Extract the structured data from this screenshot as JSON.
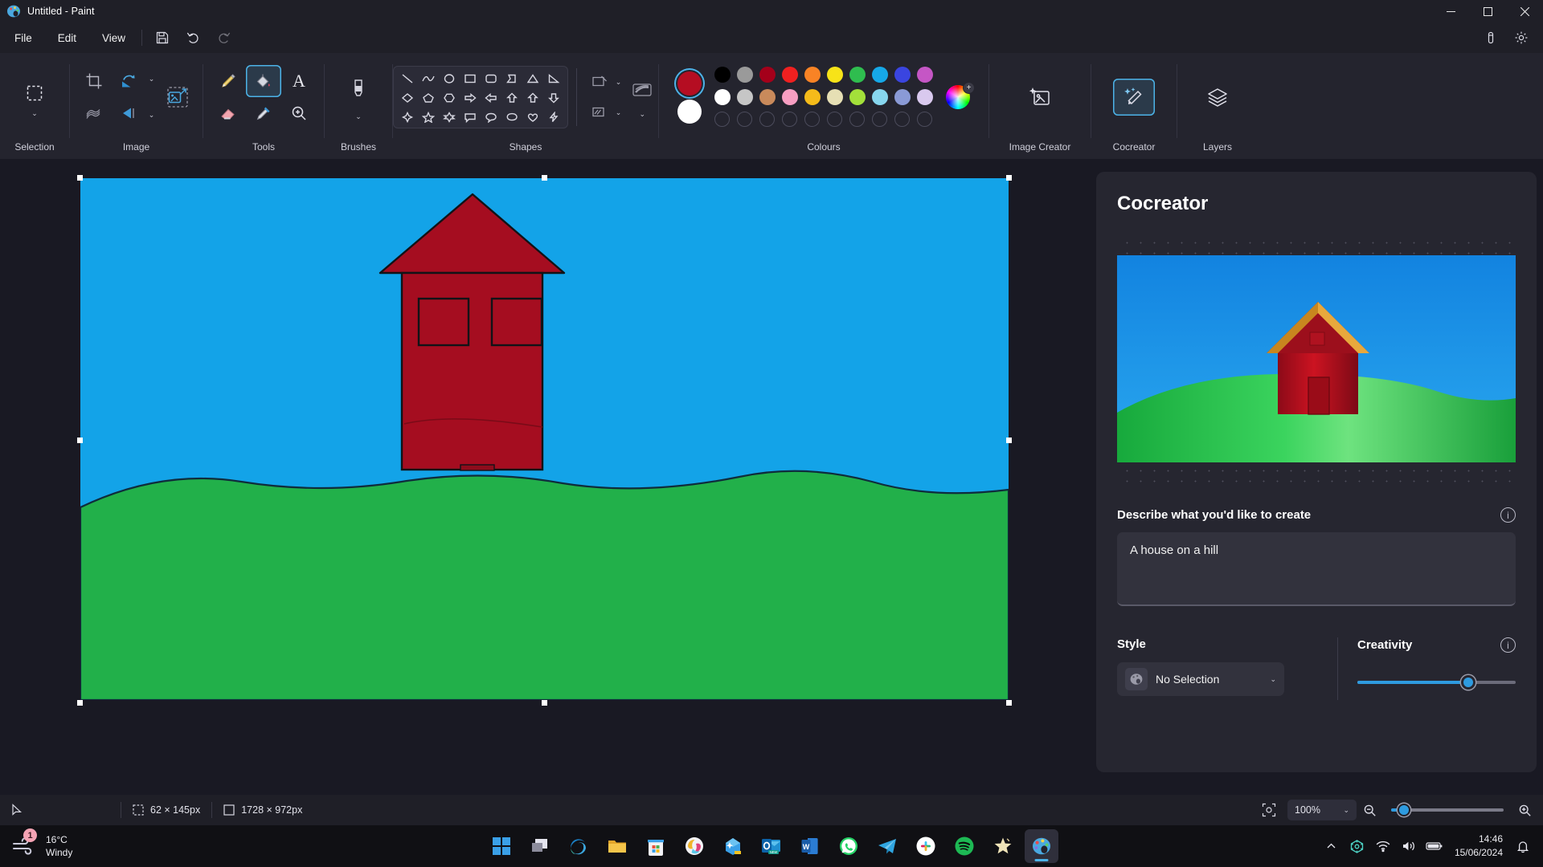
{
  "window": {
    "title": "Untitled - Paint",
    "app_icon": "paint-palette-icon",
    "minimize": "minimize-icon",
    "maximize": "maximize-icon",
    "close": "close-icon"
  },
  "menubar": {
    "items": [
      {
        "label": "File"
      },
      {
        "label": "Edit"
      },
      {
        "label": "View"
      }
    ],
    "save_icon": "save-icon",
    "undo_icon": "undo-icon",
    "redo_icon": "redo-icon",
    "pen_tip_icon": "pen-pressure-icon",
    "settings_icon": "gear-icon"
  },
  "ribbon": {
    "groups": [
      {
        "label": "Selection"
      },
      {
        "label": "Image"
      },
      {
        "label": "Tools"
      },
      {
        "label": "Brushes"
      },
      {
        "label": "Shapes"
      },
      {
        "label": "Colours"
      },
      {
        "label": "Image Creator"
      },
      {
        "label": "Cocreator"
      },
      {
        "label": "Layers"
      }
    ],
    "selection": {
      "icon": "rectangular-selection-icon",
      "caret": "chevron-down-icon"
    },
    "image": {
      "crop": "crop-icon",
      "rotate": "rotate-icon",
      "rotate_caret": "chevron-down-icon",
      "resize": "resize-skew-icon",
      "flip": "flip-icon",
      "flip_caret": "chevron-down-icon",
      "resize_image": "resize-image-icon"
    },
    "tools": {
      "pencil": "pencil-icon",
      "fill": "paint-bucket-icon",
      "text": "text-tool-icon",
      "eraser": "eraser-icon",
      "picker": "colour-picker-icon",
      "magnifier": "magnifier-icon",
      "active_tool": "paint-bucket-icon"
    },
    "brushes": {
      "icon": "brush-icon",
      "caret": "chevron-down-icon"
    },
    "shapes": {
      "items": [
        "line-shape",
        "curve-shape",
        "oval-shape",
        "rectangle-shape",
        "rounded-rectangle-shape",
        "polygon-shape",
        "triangle-shape",
        "right-triangle-shape",
        "diamond-shape",
        "pentagon-shape",
        "hexagon-shape",
        "right-arrow-shape",
        "left-arrow-shape",
        "up-arrow-shape",
        "down-arrow-shape",
        "four-point-star-shape",
        "five-point-star-shape",
        "six-point-star-shape",
        "rounded-callout-shape",
        "oval-callout-shape",
        "cloud-callout-shape",
        "heart-shape",
        "lightning-shape"
      ],
      "outline_button": "shape-outline-icon",
      "outline_caret": "chevron-down-icon",
      "fill_button": "shape-fill-icon",
      "fill_caret": "chevron-down-icon",
      "thickness_button": "line-thickness-icon",
      "thickness_caret": "chevron-down-icon"
    },
    "colours": {
      "primary": "#b50d22",
      "secondary": "#ffffff",
      "row1": [
        "#000000",
        "#9a9a9a",
        "#a4001a",
        "#f02020",
        "#f98325",
        "#f7e318",
        "#2fbd4f",
        "#16a8e8",
        "#3a45e0",
        "#c556c5"
      ],
      "row2": [
        "#ffffff",
        "#c6c6c6",
        "#c98a5b",
        "#f79ec2",
        "#f5bb1a",
        "#e6dfb4",
        "#a3e03a",
        "#87d6ee",
        "#8a9ad6",
        "#d9c9ee"
      ],
      "row3_empty_count": 10,
      "wheel_icon": "colour-wheel-icon",
      "add_colour": "add-colour-icon"
    },
    "image_creator": {
      "icon": "image-creator-icon"
    },
    "cocreator_button": {
      "icon": "cocreator-magic-wand-icon",
      "active": true
    },
    "layers": {
      "icon": "layers-icon"
    }
  },
  "canvas": {
    "sky_colour": "#13a3e8",
    "grass_colour": "#22b04a",
    "house_colour": "#a50d20",
    "outline_colour": "#101418",
    "handles": 8
  },
  "cocreator": {
    "title": "Cocreator",
    "preview_alt": "ai-generated-house-on-hill-preview",
    "prompt_label": "Describe what you'd like to create",
    "prompt_info_icon": "info-icon",
    "prompt_value": "A house on a hill",
    "prompt_placeholder": "Describe what you'd like to create",
    "style_label": "Style",
    "style_value": "No Selection",
    "style_icon": "palette-icon",
    "style_caret": "chevron-down-icon",
    "creativity_label": "Creativity",
    "creativity_info_icon": "info-icon",
    "creativity_percent": 70
  },
  "statusbar": {
    "cursor_icon": "cursor-arrow-icon",
    "selection_icon": "selection-size-icon",
    "selection_size": "62 × 145px",
    "canvas_icon": "canvas-size-icon",
    "canvas_size": "1728 × 972px",
    "fit_icon": "fit-to-window-icon",
    "zoom_value": "100%",
    "zoom_caret": "chevron-down-icon",
    "zoom_out_icon": "zoom-out-icon",
    "zoom_in_icon": "zoom-in-icon",
    "zoom_slider_percent": 8
  },
  "taskbar": {
    "weather": {
      "icon": "windy-weather-icon",
      "badge": "1",
      "temperature": "16°C",
      "condition": "Windy"
    },
    "apps": [
      {
        "name": "start-button",
        "icon": "windows-logo-icon"
      },
      {
        "name": "task-view-button",
        "icon": "task-view-icon"
      },
      {
        "name": "taskbar-app-edge",
        "icon": "microsoft-edge-icon"
      },
      {
        "name": "taskbar-app-file-explorer",
        "icon": "file-explorer-icon"
      },
      {
        "name": "taskbar-app-microsoft-store",
        "icon": "microsoft-store-icon"
      },
      {
        "name": "taskbar-app-copilot",
        "icon": "copilot-icon"
      },
      {
        "name": "taskbar-app-designer",
        "icon": "designer-icon"
      },
      {
        "name": "taskbar-app-outlook",
        "icon": "outlook-icon"
      },
      {
        "name": "taskbar-app-word",
        "icon": "word-icon"
      },
      {
        "name": "taskbar-app-whatsapp",
        "icon": "whatsapp-icon"
      },
      {
        "name": "taskbar-app-telegram",
        "icon": "telegram-icon"
      },
      {
        "name": "taskbar-app-slack",
        "icon": "slack-icon"
      },
      {
        "name": "taskbar-app-spotify",
        "icon": "spotify-icon"
      },
      {
        "name": "taskbar-app-star",
        "icon": "star-app-icon"
      },
      {
        "name": "taskbar-app-paint",
        "icon": "paint-icon"
      }
    ],
    "tray": {
      "chevron": "show-hidden-icons-icon",
      "onedrive": "onedrive-icon",
      "wifi": "wifi-icon",
      "volume": "volume-icon",
      "battery": "battery-icon",
      "notification": "notification-bell-icon",
      "time": "14:46",
      "date": "15/06/2024"
    }
  }
}
